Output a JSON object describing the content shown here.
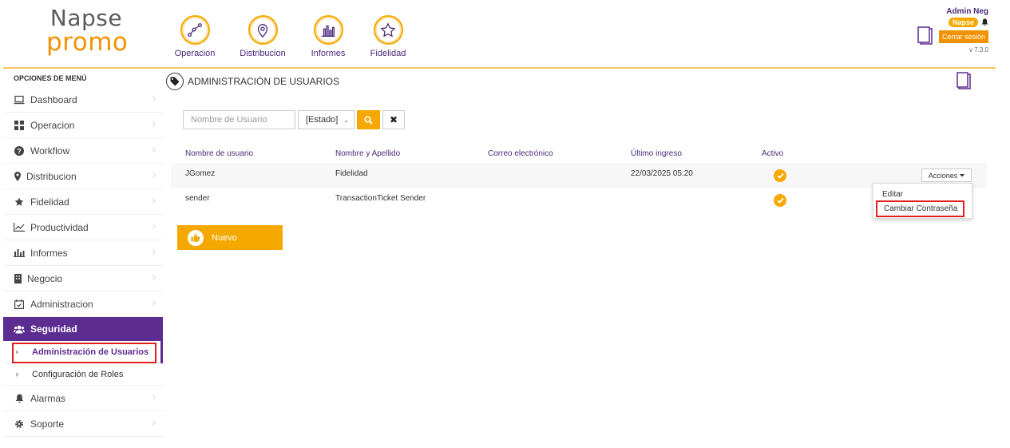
{
  "brand": {
    "line1": "Napse",
    "line2": "promo"
  },
  "topnav": [
    {
      "label": "Operacion"
    },
    {
      "label": "Distribucion"
    },
    {
      "label": "Informes"
    },
    {
      "label": "Fidelidad"
    }
  ],
  "user": {
    "name": "Admin Neg",
    "company": "Napse",
    "logout": "Cerrar sesión",
    "version": "v 7.3.0"
  },
  "sidebar": {
    "title": "OPCIONES DE MENÚ",
    "items": [
      {
        "label": "Dashboard",
        "icon": "laptop-icon"
      },
      {
        "label": "Operacion",
        "icon": "grid-icon"
      },
      {
        "label": "Workflow",
        "icon": "question-icon"
      },
      {
        "label": "Distribucion",
        "icon": "map-marker-icon"
      },
      {
        "label": "Fidelidad",
        "icon": "star-icon"
      },
      {
        "label": "Productividad",
        "icon": "line-chart-icon"
      },
      {
        "label": "Informes",
        "icon": "bar-chart-icon"
      },
      {
        "label": "Negocio",
        "icon": "building-icon"
      },
      {
        "label": "Administracion",
        "icon": "calendar-check-icon"
      },
      {
        "label": "Seguridad",
        "icon": "users-icon"
      }
    ],
    "sub_items": [
      {
        "label": "Administración de Usuarios"
      },
      {
        "label": "Configuración de Roles"
      }
    ],
    "after_items": [
      {
        "label": "Alarmas",
        "icon": "bell-icon"
      },
      {
        "label": "Soporte",
        "icon": "cog-icon"
      }
    ]
  },
  "main": {
    "title": "ADMINISTRACIÓN DE USUARIOS",
    "filter": {
      "search_placeholder": "Nombre de Usuario",
      "estado_value": "[Estado]"
    },
    "table": {
      "headers": [
        "Nombre de usuario",
        "Nombre y Apellido",
        "Correo electrónico",
        "Último ingreso",
        "Activo"
      ],
      "rows": [
        {
          "username": "JGomez",
          "fullname": "Fidelidad",
          "email": "",
          "last_login": "22/03/2025 05:20",
          "active": true
        },
        {
          "username": "sender",
          "fullname": "TransactionTicket Sender",
          "email": "",
          "last_login": "",
          "active": true
        }
      ]
    },
    "actions_label": "Acciones",
    "dropdown": {
      "edit": "Editar",
      "change_password": "Cambiar Contraseña"
    },
    "new_button": "Nuevo"
  },
  "colors": {
    "accent": "#f5a800",
    "brand_purple": "#5c2c91",
    "highlight_red": "#e02020"
  }
}
